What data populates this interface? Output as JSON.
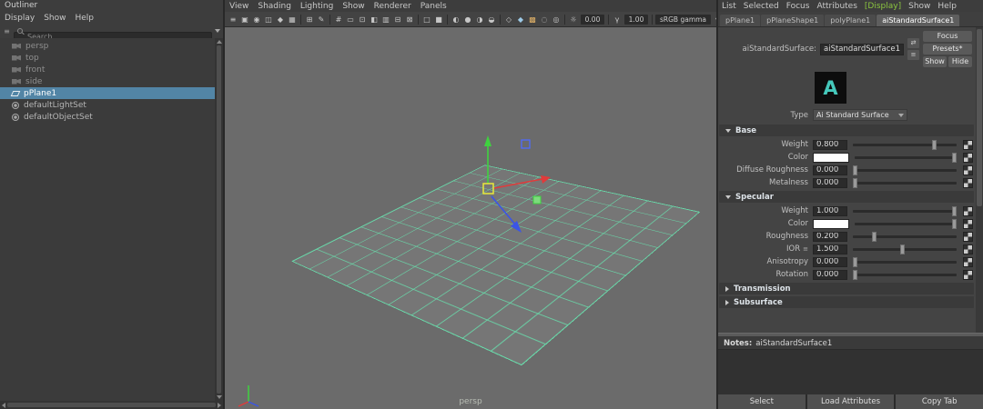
{
  "colors": {
    "selection_blue": "#5285a6",
    "grid_green": "#68dcab",
    "axis_x_red": "#e03b3b",
    "axis_y_green": "#3fd23f",
    "axis_z_blue": "#3b55e6",
    "manip_center_yellow": "#e8e83a",
    "display_menu_green": "#8bc53f",
    "arnold_teal": "#45c8bb"
  },
  "outliner": {
    "title": "Outliner",
    "menus": [
      "Display",
      "Show",
      "Help"
    ],
    "search": {
      "placeholder": "Search..."
    },
    "items": [
      {
        "label": "persp"
      },
      {
        "label": "top"
      },
      {
        "label": "front"
      },
      {
        "label": "side"
      },
      {
        "label": "pPlane1"
      },
      {
        "label": "defaultLightSet"
      },
      {
        "label": "defaultObjectSet"
      }
    ]
  },
  "viewport": {
    "menus": [
      "View",
      "Shading",
      "Lighting",
      "Show",
      "Renderer",
      "Panels"
    ],
    "camera_label": "persp",
    "toolbar_items": [
      {
        "type": "icon",
        "name": "panel-menu-icon",
        "glyph": "≡"
      },
      {
        "type": "icon",
        "name": "select-camera-icon",
        "glyph": "▣"
      },
      {
        "type": "icon",
        "name": "lock-camera-icon",
        "glyph": "◉"
      },
      {
        "type": "icon",
        "name": "camera-attributes-icon",
        "glyph": "◫"
      },
      {
        "type": "icon",
        "name": "bookmarks-icon",
        "glyph": "◆"
      },
      {
        "type": "icon",
        "name": "image-plane-icon",
        "glyph": "▦"
      },
      {
        "type": "sep"
      },
      {
        "type": "icon",
        "name": "pan-zoom-icon",
        "glyph": "⊞"
      },
      {
        "type": "icon",
        "name": "grease-pencil-icon",
        "glyph": "✎"
      },
      {
        "type": "sep"
      },
      {
        "type": "icon",
        "name": "grid-icon",
        "glyph": "#"
      },
      {
        "type": "icon",
        "name": "film-gate-icon",
        "glyph": "▭"
      },
      {
        "type": "icon",
        "name": "resolution-gate-icon",
        "glyph": "⊡"
      },
      {
        "type": "icon",
        "name": "gate-mask-icon",
        "glyph": "◧"
      },
      {
        "type": "icon",
        "name": "field-chart-icon",
        "glyph": "▥"
      },
      {
        "type": "icon",
        "name": "safe-action-icon",
        "glyph": "⊟"
      },
      {
        "type": "icon",
        "name": "safe-title-icon",
        "glyph": "⊠"
      },
      {
        "type": "sep"
      },
      {
        "type": "icon",
        "name": "frame-all-icon",
        "glyph": "□"
      },
      {
        "type": "icon",
        "name": "frame-selected-icon",
        "glyph": "■"
      },
      {
        "type": "sep"
      },
      {
        "type": "icon",
        "name": "default-lighting-icon",
        "glyph": "◐"
      },
      {
        "type": "icon",
        "name": "all-lights-icon",
        "glyph": "●"
      },
      {
        "type": "icon",
        "name": "shadows-icon",
        "glyph": "◑"
      },
      {
        "type": "icon",
        "name": "occlusion-icon",
        "glyph": "◒"
      },
      {
        "type": "sep"
      },
      {
        "type": "icon",
        "name": "wireframe-icon",
        "glyph": "◇"
      },
      {
        "type": "icon",
        "name": "shaded-icon",
        "glyph": "◆",
        "color": "#9ecbe8"
      },
      {
        "type": "icon",
        "name": "textured-icon",
        "glyph": "▩",
        "color": "#dfb067"
      },
      {
        "type": "icon",
        "name": "xray-icon",
        "glyph": "◌"
      },
      {
        "type": "icon",
        "name": "isolate-select-icon",
        "glyph": "◎"
      },
      {
        "type": "sep"
      },
      {
        "type": "icon",
        "name": "exposure-icon",
        "glyph": "☼"
      },
      {
        "type": "field",
        "name": "exposure-field",
        "value": "0.00"
      },
      {
        "type": "sep"
      },
      {
        "type": "icon",
        "name": "gamma-icon",
        "glyph": "γ"
      },
      {
        "type": "field",
        "name": "gamma-field",
        "value": "1.00"
      },
      {
        "type": "sep"
      },
      {
        "type": "select",
        "name": "view-transform-select",
        "value": "sRGB gamma"
      },
      {
        "type": "icon",
        "name": "dropdown-arrow-icon",
        "glyph": "▾"
      }
    ]
  },
  "attribute_editor": {
    "menus": [
      "List",
      "Selected",
      "Focus",
      "Attributes",
      "[Display]",
      "Show",
      "Help"
    ],
    "tabs": [
      "pPlane1",
      "pPlaneShape1",
      "polyPlane1",
      "aiStandardSurface1"
    ],
    "active_tab": "aiStandardSurface1",
    "header": {
      "label": "aiStandardSurface:",
      "name_value": "aiStandardSurface1",
      "focus_button": "Focus",
      "presets_button": "Presets*",
      "show_button": "Show",
      "hide_button": "Hide",
      "mini_icons": [
        {
          "name": "swap-node-icon",
          "glyph": "⇄"
        },
        {
          "name": "list-connections-icon",
          "glyph": "≡"
        }
      ]
    },
    "logo_letter": "A",
    "type": {
      "label": "Type",
      "value": "Ai Standard Surface"
    },
    "sections": [
      {
        "title": "Base",
        "expanded": true,
        "rows": [
          {
            "label": "Weight",
            "value": "0.800",
            "slider": 0.8
          },
          {
            "label": "Color",
            "swatch": "#ffffff",
            "slider": 1.0
          },
          {
            "label": "Diffuse Roughness",
            "value": "0.000",
            "slider": 0.0
          },
          {
            "label": "Metalness",
            "value": "0.000",
            "slider": 0.0
          }
        ]
      },
      {
        "title": "Specular",
        "expanded": true,
        "rows": [
          {
            "label": "Weight",
            "value": "1.000",
            "slider": 1.0
          },
          {
            "label": "Color",
            "swatch": "#ffffff",
            "slider": 1.0
          },
          {
            "label": "Roughness",
            "value": "0.200",
            "slider": 0.19
          },
          {
            "label": "IOR",
            "icon": "≡",
            "value": "1.500",
            "slider": 0.48
          },
          {
            "label": "Anisotropy",
            "value": "0.000",
            "slider": 0.0
          },
          {
            "label": "Rotation",
            "value": "0.000",
            "slider": 0.0
          }
        ]
      },
      {
        "title": "Transmission",
        "expanded": false
      },
      {
        "title": "Subsurface",
        "expanded": false
      }
    ],
    "notes": {
      "label": "Notes:",
      "value": "aiStandardSurface1"
    },
    "footer_buttons": [
      "Select",
      "Load Attributes",
      "Copy Tab"
    ]
  }
}
